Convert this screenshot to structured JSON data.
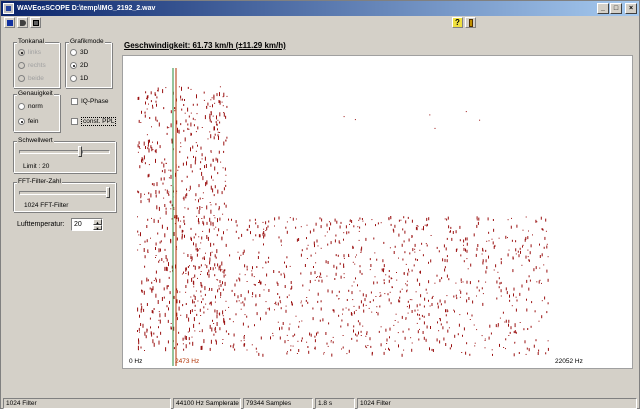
{
  "window": {
    "title": "WAVEosSCOPE D:\\temp\\IMG_2192_2.wav",
    "minimize": "_",
    "maximize": "□",
    "close": "×"
  },
  "toolbar": {
    "help_label": "?"
  },
  "tonkanal": {
    "legend": "Tonkanal",
    "options": [
      "links",
      "rechts",
      "beide"
    ]
  },
  "grafikmode": {
    "legend": "Grafikmode",
    "options": [
      "3D",
      "2D",
      "1D"
    ],
    "selected": "2D"
  },
  "genauigkeit": {
    "legend": "Genauigkeit",
    "options": [
      "norm",
      "fein"
    ],
    "selected": "fein"
  },
  "checks": {
    "iq_phase": "IQ-Phase",
    "const_ppl": "const. PPL"
  },
  "schwellwert": {
    "legend": "Schwellwert",
    "limit_label": "Limit : 20"
  },
  "fft": {
    "legend": "FFT-Filter-Zahl",
    "filter_label": "1024 FFT-Filter"
  },
  "lufttemperatur": {
    "label": "Lufttemperatur:",
    "value": "20"
  },
  "speed_readout": "Geschwindigkeit: 61.73 km/h (±11.29 km/h)",
  "plot": {
    "x_min_label": "0 Hz",
    "marker_label": "2473 Hz",
    "x_max_label": "22052 Hz",
    "marker_color": "#b03000",
    "line_color": "#2a8a3a",
    "dot_color": "#9a1010"
  },
  "status": {
    "cells": [
      "1024 Filter",
      "44100 Hz Samplerate",
      "79344 Samples",
      "1.8 s",
      "1024 Filter"
    ]
  }
}
